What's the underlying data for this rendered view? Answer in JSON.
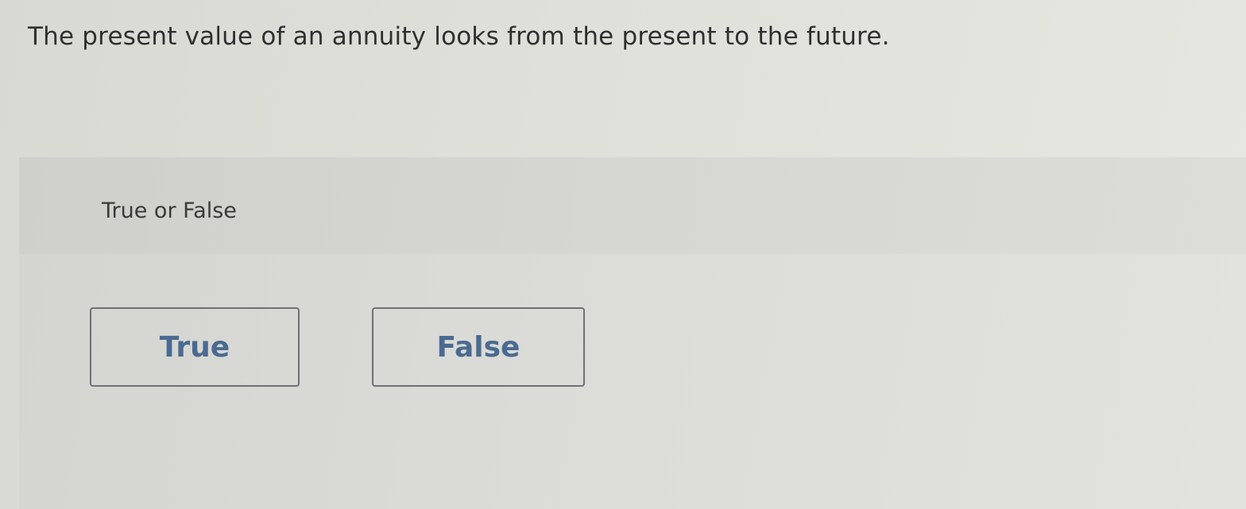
{
  "question": {
    "text": "The present value of an annuity looks from the present to the future."
  },
  "answer": {
    "prompt": "True or False",
    "options": [
      {
        "label": "True"
      },
      {
        "label": "False"
      }
    ]
  },
  "colors": {
    "page_background": "#e0e0db",
    "prompt_band": "#d6d6d2",
    "button_border": "#6e7076",
    "button_text": "#4a6a92",
    "text": "#2f2f2f"
  }
}
